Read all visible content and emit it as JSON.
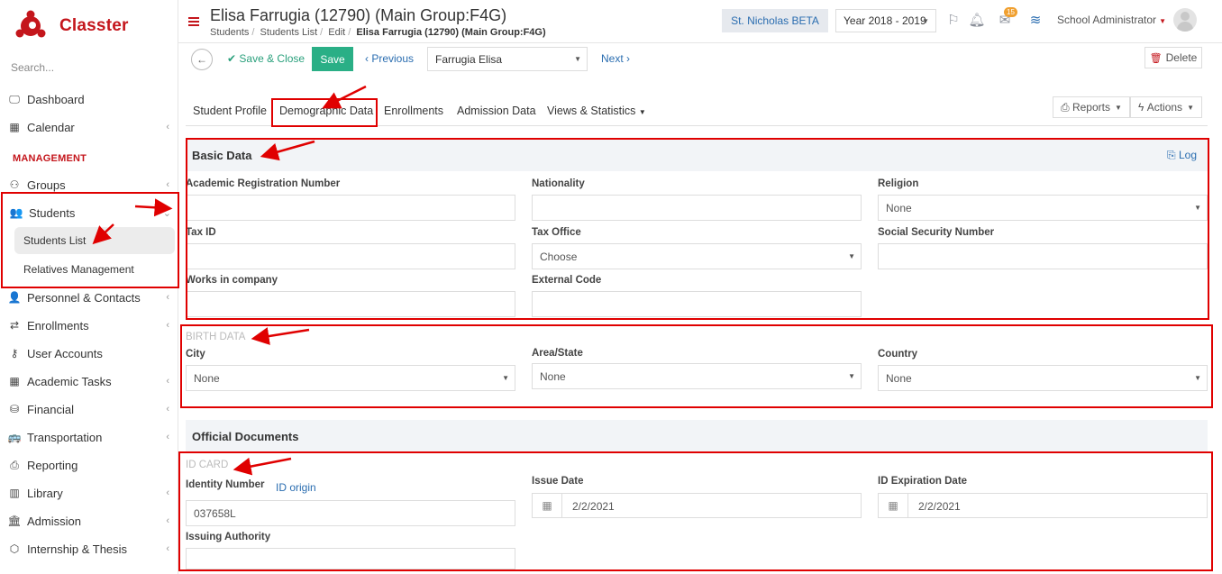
{
  "app": {
    "name": "Classter",
    "search_placeholder": "Search..."
  },
  "sidebar": {
    "items_top": [
      {
        "label": "Dashboard"
      },
      {
        "label": "Calendar"
      }
    ],
    "management_label": "MANAGEMENT",
    "items": [
      {
        "label": "Groups"
      },
      {
        "label": "Students"
      },
      {
        "label": "Personnel & Contacts"
      },
      {
        "label": "Enrollments"
      },
      {
        "label": "User Accounts"
      },
      {
        "label": "Academic Tasks"
      },
      {
        "label": "Financial"
      },
      {
        "label": "Transportation"
      },
      {
        "label": "Reporting"
      },
      {
        "label": "Library"
      },
      {
        "label": "Admission"
      },
      {
        "label": "Internship & Thesis"
      }
    ],
    "students_sub": [
      {
        "label": "Students List"
      },
      {
        "label": "Relatives Management"
      }
    ]
  },
  "header": {
    "title": "Elisa Farrugia (12790) (Main Group:F4G)",
    "breadcrumb": [
      "Students",
      "Students List",
      "Edit",
      "Elisa Farrugia (12790) (Main Group:F4G)"
    ],
    "school": "St. Nicholas BETA",
    "year": "Year 2018 - 2019",
    "mail_count": "15",
    "user": "School Administrator"
  },
  "toolbar": {
    "save_close": "Save & Close",
    "save": "Save",
    "previous": "Previous",
    "student_selected": "Farrugia Elisa",
    "next": "Next",
    "delete": "Delete"
  },
  "tabs": [
    "Student Profile",
    "Demographic Data",
    "Enrollments",
    "Admission Data",
    "Views & Statistics"
  ],
  "actions": {
    "reports": "Reports",
    "actions": "Actions"
  },
  "basic_data": {
    "title": "Basic Data",
    "log": "Log",
    "fields": {
      "academic_reg": {
        "label": "Academic Registration Number",
        "value": ""
      },
      "nationality": {
        "label": "Nationality",
        "value": ""
      },
      "religion": {
        "label": "Religion",
        "value": "None"
      },
      "tax_id": {
        "label": "Tax ID",
        "value": ""
      },
      "tax_office": {
        "label": "Tax Office",
        "value": "Choose"
      },
      "ssn": {
        "label": "Social Security Number",
        "value": ""
      },
      "works_in": {
        "label": "Works in company",
        "value": ""
      },
      "external_code": {
        "label": "External Code",
        "value": ""
      }
    }
  },
  "birth_data": {
    "title": "BIRTH DATA",
    "city": {
      "label": "City",
      "value": "None"
    },
    "area": {
      "label": "Area/State",
      "value": "None"
    },
    "country": {
      "label": "Country",
      "value": "None"
    }
  },
  "official_docs": {
    "title": "Official Documents",
    "id_card_title": "ID CARD",
    "identity_number": {
      "label": "Identity Number",
      "value": "037658L"
    },
    "id_origin": "ID origin",
    "issue_date": {
      "label": "Issue Date",
      "value": "2/2/2021"
    },
    "expiration_date": {
      "label": "ID Expiration Date",
      "value": "2/2/2021"
    },
    "issuing_authority": {
      "label": "Issuing Authority",
      "value": ""
    }
  },
  "colors": {
    "brand": "#c4161c",
    "save": "#2aaf86",
    "link": "#2a6db0",
    "annotation": "#e00000"
  }
}
